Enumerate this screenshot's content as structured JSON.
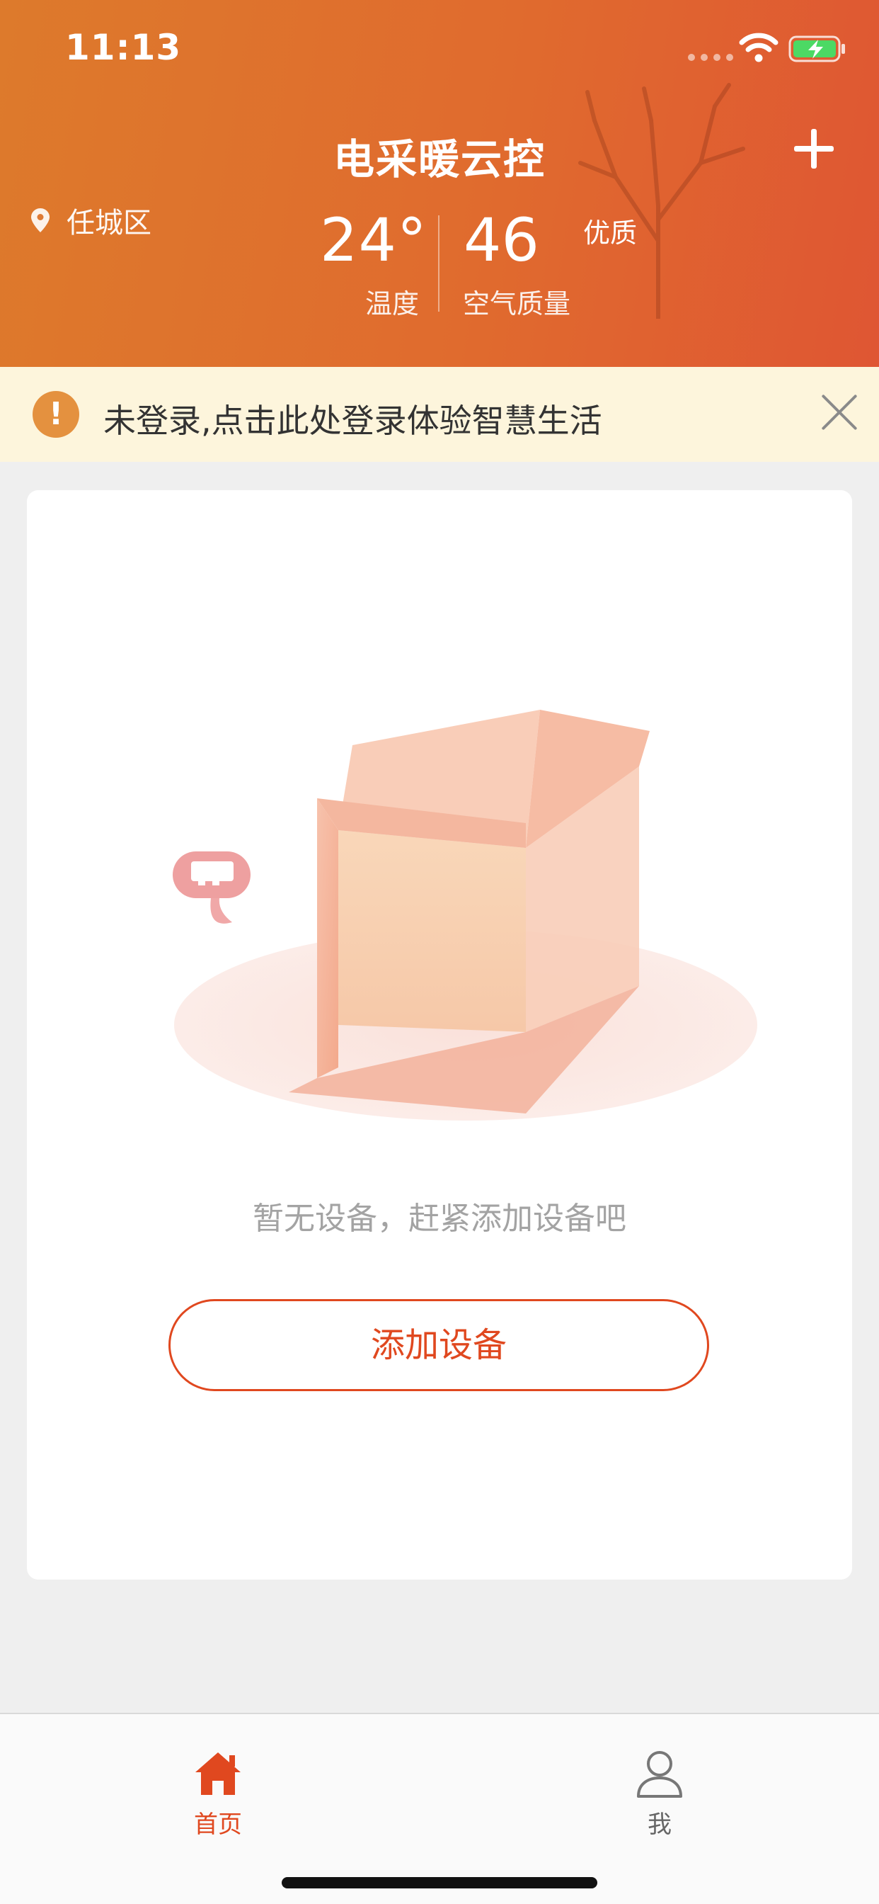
{
  "status_bar": {
    "time": "11:13"
  },
  "header": {
    "title": "电采暖云控",
    "location": "任城区",
    "temperature": {
      "value": "24°",
      "label": "温度"
    },
    "air_quality": {
      "value": "46",
      "label": "空气质量",
      "level": "优质"
    }
  },
  "login_banner": {
    "icon": "!",
    "text": "未登录,点击此处登录体验智慧生活"
  },
  "empty_state": {
    "message": "暂无设备，赶紧添加设备吧",
    "add_button_label": "添加设备"
  },
  "tab_bar": {
    "items": [
      {
        "label": "首页",
        "icon": "home-icon",
        "active": true
      },
      {
        "label": "我",
        "icon": "person-icon",
        "active": false
      }
    ]
  },
  "colors": {
    "header_start": "#dd7a2c",
    "header_end": "#df5633",
    "accent": "#e0481f",
    "banner_bg": "#fdf5dc",
    "warning": "#e4913f"
  }
}
